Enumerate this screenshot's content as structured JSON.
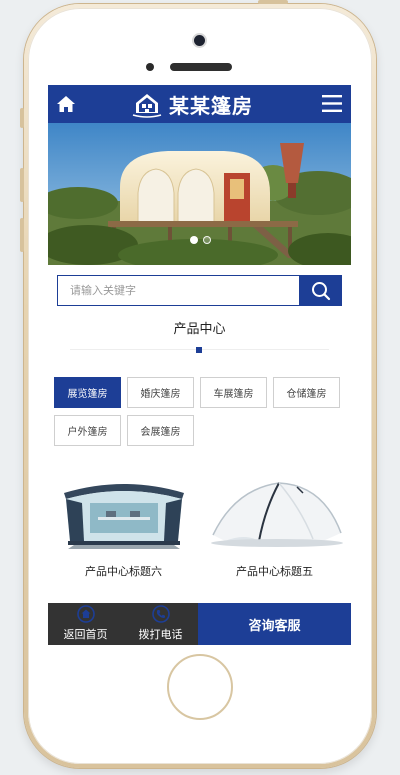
{
  "header": {
    "site_title": "某某篷房"
  },
  "banner": {
    "slide_count": 2,
    "active_slide": 1
  },
  "search": {
    "placeholder": "请输入关键字"
  },
  "section": {
    "title": "产品中心"
  },
  "categories": [
    {
      "label": "展览篷房",
      "active": true
    },
    {
      "label": "婚庆篷房",
      "active": false
    },
    {
      "label": "车展篷房",
      "active": false
    },
    {
      "label": "仓储篷房",
      "active": false
    },
    {
      "label": "户外篷房",
      "active": false
    },
    {
      "label": "会展篷房",
      "active": false
    }
  ],
  "products": [
    {
      "name": "产品中心标题六",
      "image": "blue-frame-canopy-tent"
    },
    {
      "name": "产品中心标题五",
      "image": "white-dome-tent"
    }
  ],
  "bottom_nav": {
    "home_label": "返回首页",
    "phone_label": "拨打电话",
    "consult_label": "咨询客服"
  },
  "icons": {
    "home": "home-icon",
    "menu": "menu-icon",
    "search": "search-icon",
    "phone": "phone-icon",
    "logo": "house-logo-icon"
  },
  "colors": {
    "brand_blue": "#1d3e96",
    "bottom_dark": "#333333",
    "phone_gold": "#e6d3b0"
  }
}
